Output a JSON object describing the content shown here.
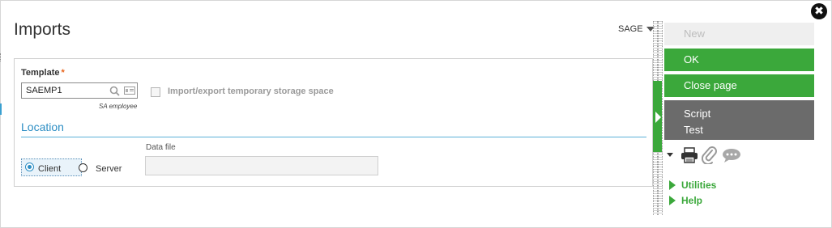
{
  "page": {
    "title": "Imports",
    "user_menu": "SAGE"
  },
  "template": {
    "label": "Template",
    "required_mark": "*",
    "value": "SAEMP1",
    "description": "SA employee"
  },
  "storage_checkbox": {
    "label": "Import/export temporary storage space",
    "checked": false
  },
  "location": {
    "title": "Location",
    "options": [
      "Client",
      "Server"
    ],
    "selected": "Client",
    "data_file_label": "Data file",
    "data_file_value": ""
  },
  "actions": {
    "new_label": "New",
    "ok_label": "OK",
    "close_label": "Close page",
    "script_label": "Script",
    "test_label": "Test"
  },
  "tool_icons": [
    "print-icon",
    "paperclip-icon",
    "comment-icon"
  ],
  "sections": {
    "utilities": "Utilities",
    "help": "Help"
  },
  "colors": {
    "accent_green": "#3ba83b",
    "link_blue": "#2d8ec4",
    "required": "#e8641b",
    "dark_button": "#6b6b6b"
  }
}
